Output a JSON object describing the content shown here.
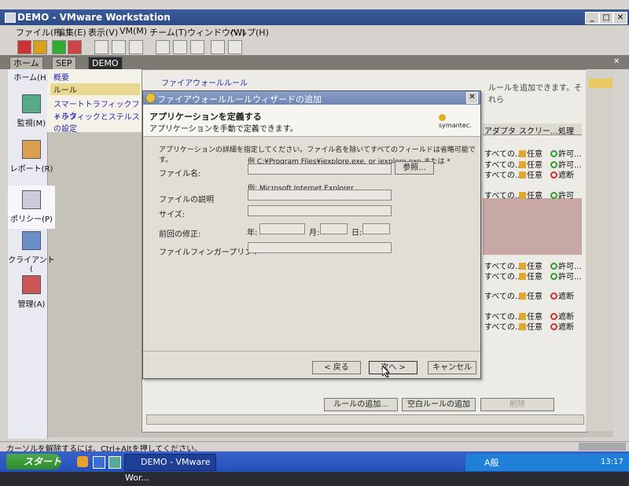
{
  "window": {
    "title": "DEMO - VMware Workstation"
  },
  "menu": [
    "ファイル(F)",
    "編集(E)",
    "表示(V)",
    "VM(M)",
    "チーム(T)",
    "ウィンドウ(W)",
    "ヘルプ(H)"
  ],
  "tabs": [
    "ホーム",
    "SEP",
    "DEMO"
  ],
  "leftnav": [
    "ホーム(H)",
    "監視(M)",
    "レポート(R)",
    "ポリシー(P)",
    "クライアント(",
    "管理(A)"
  ],
  "subnav": [
    "概要",
    "ルール",
    "スマートトラフィックフィルタ",
    "トラフィックとステルスの設定"
  ],
  "main": {
    "section_label": "ファイアウォールルール",
    "hint_text": "ルールを追加できます。それら"
  },
  "rules": {
    "columns": [
      "アダプタ",
      "スクリー...",
      "処理"
    ],
    "rows": [
      [
        "すべての...",
        "任意",
        "許可..."
      ],
      [
        "すべての...",
        "任意",
        "許可..."
      ],
      [
        "すべての...",
        "任意",
        "遮断"
      ],
      [
        "すべての...",
        "任意",
        "許可"
      ],
      [
        "すべての...",
        "任意",
        "許可..."
      ],
      [
        "すべての...",
        "任意",
        "許可..."
      ],
      [
        "すべての...",
        "任意",
        "遮断"
      ],
      [
        "すべての...",
        "任意",
        "遮断"
      ],
      [
        "すべての...",
        "任意",
        "遮断"
      ]
    ]
  },
  "dialog": {
    "title": "ファイアウォールルールウィザードの追加",
    "heading": "アプリケーションを定義する",
    "subheading": "アプリケーションを手動で定義できます。",
    "brand": "symantec.",
    "intro": "アプリケーションの詳細を指定してください。ファイル名を除いてすべてのフィールドは省略可能です。",
    "example_file": "例 C:¥Program Files¥iexplore.exe, or iexplore.exe または *",
    "label_filename": "ファイル名:",
    "browse": "参照...",
    "example_desc": "例: Microsoft Internet Explorer",
    "label_desc": "ファイルの説明",
    "label_size": "サイズ:",
    "label_modified": "前回の修正:",
    "year": "年:",
    "month": "月:",
    "day": "日:",
    "label_fingerprint": "ファイルフィンガープリント",
    "back": "< 戻る",
    "next": "次へ >",
    "cancel": "キャンセル"
  },
  "bottom_buttons": {
    "add_rule": "ルールの追加...",
    "add_blank": "空白ルールの追加",
    "delete": "削除"
  },
  "statusbar": "カーソルを解除するには、Ctrl+Altを押してください。",
  "taskbar": {
    "start": "スタート",
    "task": "DEMO - VMware Wor...",
    "clock": "13:17",
    "ime": "A般"
  }
}
